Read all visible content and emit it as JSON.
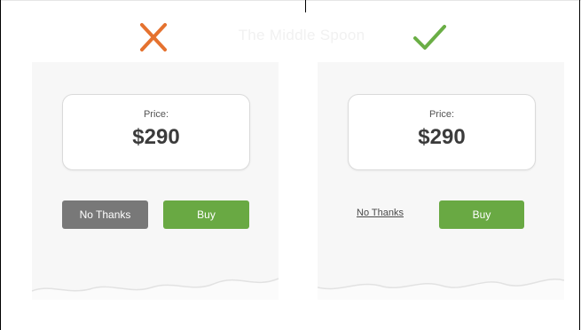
{
  "header": {
    "watermark": "The Middle Spoon"
  },
  "examples": {
    "bad": {
      "indicator_icon": "x-icon",
      "indicator_color": "#e5722f",
      "price_label": "Price:",
      "price_value": "$290",
      "decline_label": "No Thanks",
      "accept_label": "Buy"
    },
    "good": {
      "indicator_icon": "checkmark-icon",
      "indicator_color": "#6aae45",
      "price_label": "Price:",
      "price_value": "$290",
      "decline_label": "No Thanks",
      "accept_label": "Buy"
    }
  },
  "colors": {
    "buy_green": "#69a943",
    "decline_grey": "#787878"
  }
}
